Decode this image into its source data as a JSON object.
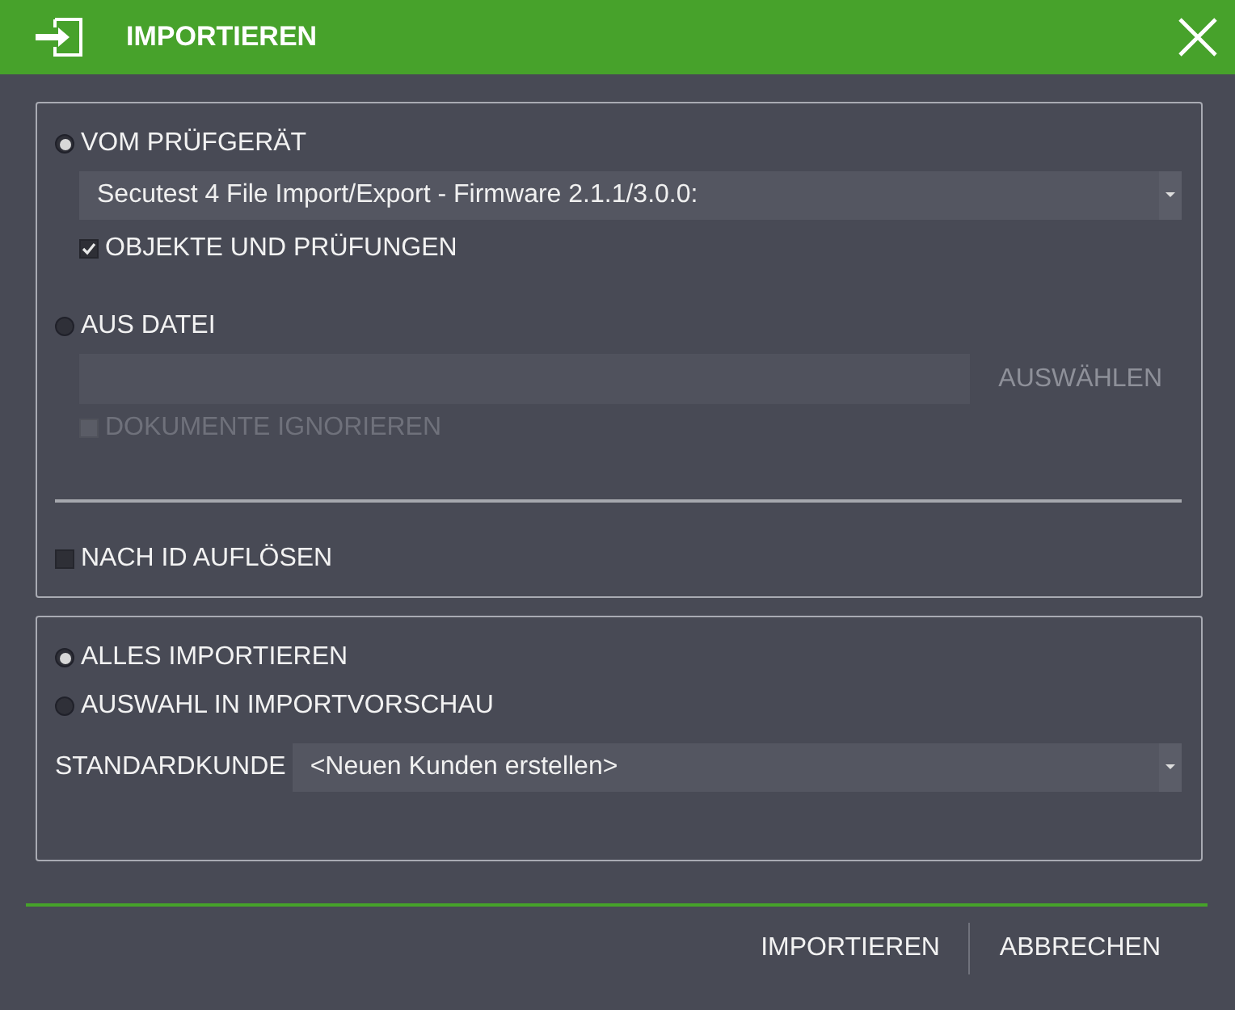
{
  "header": {
    "title": "IMPORTIEREN"
  },
  "source": {
    "device_option": {
      "label": "VOM PRÜFGERÄT",
      "selected": true
    },
    "device_select": {
      "value": "Secutest 4 File Import/Export - Firmware 2.1.1/3.0.0:"
    },
    "objects_checkbox": {
      "label": "OBJEKTE UND PRÜFUNGEN",
      "checked": true,
      "disabled": false
    },
    "file_option": {
      "label": "AUS DATEI",
      "selected": false
    },
    "browse_button": {
      "label": "AUSWÄHLEN",
      "disabled": true
    },
    "ignore_checkbox": {
      "label": "DOKUMENTE IGNORIEREN",
      "checked": false,
      "disabled": true
    },
    "resolve_checkbox": {
      "label": "NACH ID AUFLÖSEN",
      "checked": false,
      "disabled": false
    }
  },
  "mode": {
    "options": [
      {
        "label": "ALLES IMPORTIEREN",
        "selected": true
      },
      {
        "label": "AUSWAHL IN IMPORTVORSCHAU",
        "selected": false
      }
    ],
    "customer": {
      "label": "STANDARDKUNDE",
      "value": "<Neuen Kunden erstellen>"
    }
  },
  "buttons": [
    {
      "label": "IMPORTIEREN"
    },
    {
      "label": "ABBRECHEN"
    }
  ]
}
